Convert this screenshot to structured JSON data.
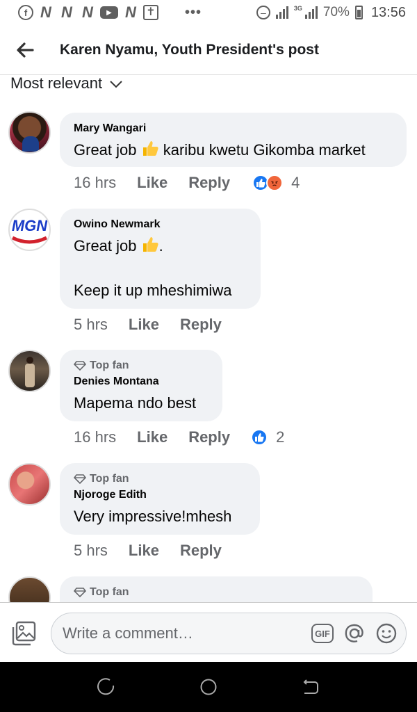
{
  "status_bar": {
    "battery": "70%",
    "time": "13:56",
    "network": "3G",
    "icons": [
      "facebook-icon",
      "notification-n-icon",
      "notification-n-icon",
      "notification-n-icon",
      "youtube-icon",
      "notification-n-icon",
      "bible-icon",
      "more-dots-icon"
    ]
  },
  "header": {
    "back_icon": "arrow-left-icon",
    "title": "Karen Nyamu, Youth President's post"
  },
  "sort": {
    "label": "Most relevant"
  },
  "labels": {
    "top_fan": "Top fan",
    "like": "Like",
    "reply": "Reply"
  },
  "comments": [
    {
      "author": "Mary Wangari",
      "text_a": "Great job ",
      "text_b": " karibu kwetu Gikomba market",
      "time": "16 hrs",
      "reactions": [
        "like",
        "angry"
      ],
      "reaction_count": "4",
      "top_fan": false
    },
    {
      "author": "Owino Newmark",
      "text_a": "Great job ",
      "text_b": ".",
      "text_c": "Keep it up mheshimiwa",
      "time": "5 hrs",
      "top_fan": false
    },
    {
      "author": "Denies Montana",
      "text": "Mapema ndo best",
      "time": "16 hrs",
      "reactions": [
        "like"
      ],
      "reaction_count": "2",
      "top_fan": true
    },
    {
      "author": "Njoroge Edith",
      "text": "Very impressive!mhesh",
      "time": "5 hrs",
      "top_fan": true
    },
    {
      "top_fan": true
    }
  ],
  "composer": {
    "placeholder": "Write a comment…",
    "gif_label": "GIF"
  },
  "colors": {
    "facebook_blue": "#1877f2",
    "bubble_bg": "#f0f2f5",
    "meta_gray": "#65676b"
  }
}
